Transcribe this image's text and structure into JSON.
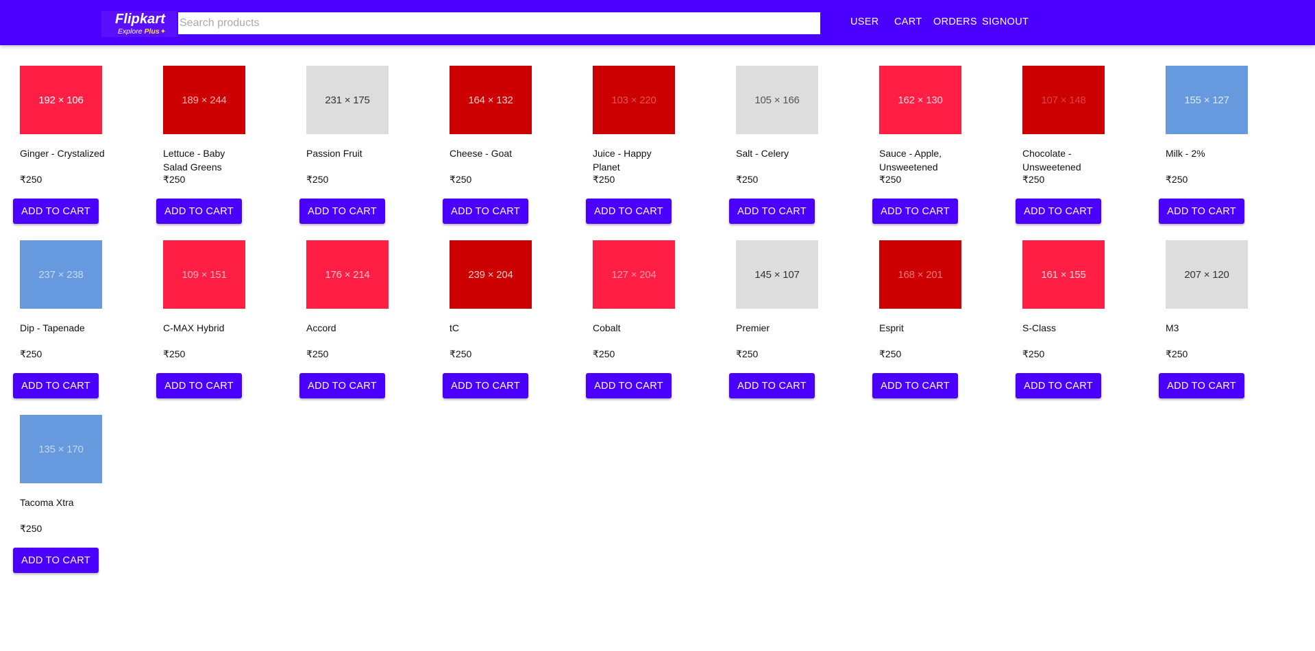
{
  "header": {
    "logo_title": "Flipkart",
    "logo_sub_text": "Explore ",
    "logo_sub_plus": "Plus",
    "search_placeholder": "Search products",
    "nav": [
      "USER",
      "CART",
      "ORDERS",
      "SIGNOUT"
    ]
  },
  "colors": {
    "appbar": "#4b00ff",
    "button": "#4b00ff",
    "button_text": "#ffffff"
  },
  "products": [
    {
      "name": "Ginger - Crystalized",
      "price": "₹250",
      "image_label": "192 × 106",
      "image_bg": "#ff1f44",
      "image_fg": "#ffffff",
      "button": "ADD TO CART"
    },
    {
      "name": "Lettuce - Baby Salad Greens",
      "price": "₹250",
      "image_label": "189 × 244",
      "image_bg": "#cc0000",
      "image_fg": "#ffb3b3",
      "button": "ADD TO CART"
    },
    {
      "name": "Passion Fruit",
      "price": "₹250",
      "image_label": "231 × 175",
      "image_bg": "#dddddd",
      "image_fg": "#333333",
      "button": "ADD TO CART"
    },
    {
      "name": "Cheese - Goat",
      "price": "₹250",
      "image_label": "164 × 132",
      "image_bg": "#cc0000",
      "image_fg": "#ffd0d0",
      "button": "ADD TO CART"
    },
    {
      "name": "Juice - Happy Planet",
      "price": "₹250",
      "image_label": "103 × 220",
      "image_bg": "#cc0000",
      "image_fg": "#e05555",
      "button": "ADD TO CART"
    },
    {
      "name": "Salt - Celery",
      "price": "₹250",
      "image_label": "105 × 166",
      "image_bg": "#dddddd",
      "image_fg": "#555555",
      "button": "ADD TO CART"
    },
    {
      "name": "Sauce - Apple, Unsweetened",
      "price": "₹250",
      "image_label": "162 × 130",
      "image_bg": "#ff1f44",
      "image_fg": "#ffd6dd",
      "button": "ADD TO CART"
    },
    {
      "name": "Chocolate - Unsweetened",
      "price": "₹250",
      "image_label": "107 × 148",
      "image_bg": "#cc0000",
      "image_fg": "#dd4444",
      "button": "ADD TO CART"
    },
    {
      "name": "Milk - 2%",
      "price": "₹250",
      "image_label": "155 × 127",
      "image_bg": "#6699dd",
      "image_fg": "#e0eaff",
      "button": "ADD TO CART"
    },
    {
      "name": "Dip - Tapenade",
      "price": "₹250",
      "image_label": "237 × 238",
      "image_bg": "#6699dd",
      "image_fg": "#c7d9f5",
      "button": "ADD TO CART"
    },
    {
      "name": "C-MAX Hybrid",
      "price": "₹250",
      "image_label": "109 × 151",
      "image_bg": "#ff1f44",
      "image_fg": "#ffb0bf",
      "button": "ADD TO CART"
    },
    {
      "name": "Accord",
      "price": "₹250",
      "image_label": "176 × 214",
      "image_bg": "#ff1f44",
      "image_fg": "#ffc4cf",
      "button": "ADD TO CART"
    },
    {
      "name": "tC",
      "price": "₹250",
      "image_label": "239 × 204",
      "image_bg": "#cc0000",
      "image_fg": "#ffcccc",
      "button": "ADD TO CART"
    },
    {
      "name": "Cobalt",
      "price": "₹250",
      "image_label": "127 × 204",
      "image_bg": "#ff1f44",
      "image_fg": "#ff9aab",
      "button": "ADD TO CART"
    },
    {
      "name": "Premier",
      "price": "₹250",
      "image_label": "145 × 107",
      "image_bg": "#dddddd",
      "image_fg": "#333333",
      "button": "ADD TO CART"
    },
    {
      "name": "Esprit",
      "price": "₹250",
      "image_label": "168 × 201",
      "image_bg": "#cc0000",
      "image_fg": "#f07777",
      "button": "ADD TO CART"
    },
    {
      "name": "S-Class",
      "price": "₹250",
      "image_label": "161 × 155",
      "image_bg": "#ff1f44",
      "image_fg": "#ffd6dd",
      "button": "ADD TO CART"
    },
    {
      "name": "M3",
      "price": "₹250",
      "image_label": "207 × 120",
      "image_bg": "#dddddd",
      "image_fg": "#333333",
      "button": "ADD TO CART"
    },
    {
      "name": "Tacoma Xtra",
      "price": "₹250",
      "image_label": "135 × 170",
      "image_bg": "#6699dd",
      "image_fg": "#c7d9f5",
      "button": "ADD TO CART"
    }
  ]
}
